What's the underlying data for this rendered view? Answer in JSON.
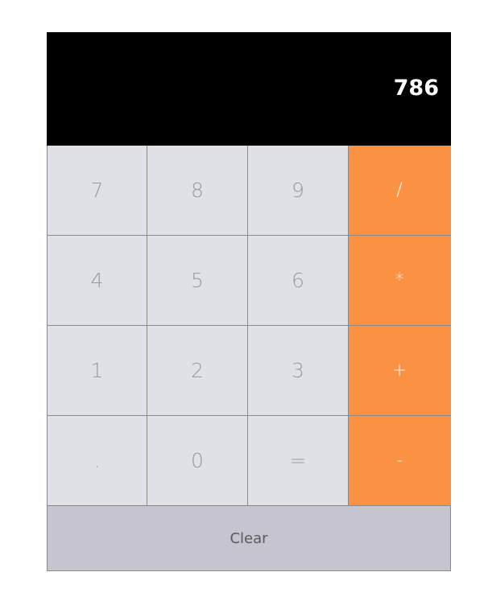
{
  "display": {
    "value": "786"
  },
  "keys": [
    {
      "label": "7",
      "type": "num"
    },
    {
      "label": "8",
      "type": "num"
    },
    {
      "label": "9",
      "type": "num"
    },
    {
      "label": "/",
      "type": "op"
    },
    {
      "label": "4",
      "type": "num"
    },
    {
      "label": "5",
      "type": "num"
    },
    {
      "label": "6",
      "type": "num"
    },
    {
      "label": "*",
      "type": "op"
    },
    {
      "label": "1",
      "type": "num"
    },
    {
      "label": "2",
      "type": "num"
    },
    {
      "label": "3",
      "type": "num"
    },
    {
      "label": "+",
      "type": "op"
    },
    {
      "label": ".",
      "type": "num"
    },
    {
      "label": "0",
      "type": "num"
    },
    {
      "label": "=",
      "type": "num"
    },
    {
      "label": "-",
      "type": "op"
    }
  ],
  "clear": {
    "label": "Clear"
  },
  "colors": {
    "display_bg": "#000000",
    "display_text": "#ffffff",
    "key_bg": "#e0e1e6",
    "key_text": "#9a9a9a",
    "operator_bg": "#fb9142",
    "operator_text": "#ffffff",
    "clear_bg": "#c6c4cf"
  }
}
